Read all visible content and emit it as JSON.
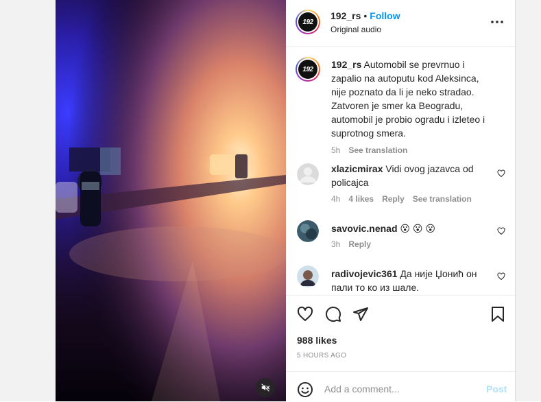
{
  "post": {
    "username": "192_rs",
    "avatar_text": "192",
    "follow_label": "Follow",
    "separator": "•",
    "audio_label": "Original audio",
    "more_icon": "more-horizontal-icon"
  },
  "caption": {
    "username": "192_rs",
    "text": "Automobil se prevrnuo i zapalio na autoputu kod Aleksinca, nije poznato da li je neko stradao. Zatvoren je smer ka Beogradu, automobil je probio ogradu i izleteo i suprotnog smera.",
    "time": "5h",
    "translate_label": "See translation"
  },
  "comments": [
    {
      "username": "xlazicmirax",
      "text": "Vidi ovog jazavca od policajca",
      "time": "4h",
      "likes": "4 likes",
      "reply_label": "Reply",
      "translate_label": "See translation"
    },
    {
      "username": "savovic.nenad",
      "text": "😮 😮 😮",
      "time": "3h",
      "reply_label": "Reply"
    },
    {
      "username": "radivojevic361",
      "text": "Да није Џонић он пали то ко из шале."
    }
  ],
  "stats": {
    "likes": "988 likes",
    "time_ago": "5 HOURS AGO"
  },
  "composer": {
    "placeholder": "Add a comment...",
    "post_label": "Post"
  },
  "colors": {
    "accent": "#0095f6",
    "muted": "#8e8e8e",
    "post_disabled": "#b2dffc"
  }
}
